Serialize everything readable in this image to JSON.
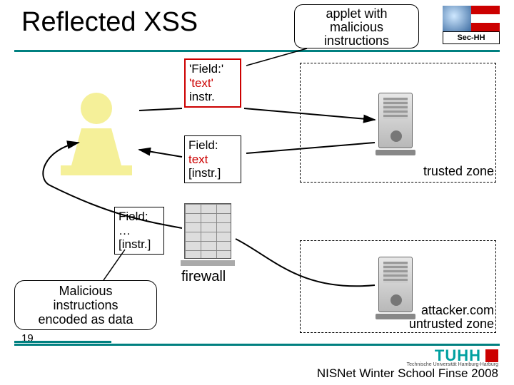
{
  "title": "Reflected XSS",
  "applet_bubble": {
    "l1": "applet with",
    "l2": "malicious",
    "l3": "instructions"
  },
  "sechh_label": "Sec-HH",
  "msg1": {
    "l1": "'Field:'",
    "l2": "'text'",
    "l3": "instr."
  },
  "msg2": {
    "l1": "Field:",
    "l2": "text",
    "l3": "[instr.]"
  },
  "msg3": {
    "l1": "Field:",
    "l2": "…",
    "l3": "[instr.]"
  },
  "zones": {
    "trusted": "trusted zone",
    "attacker": "attacker.com",
    "untrusted": "untrusted zone"
  },
  "firewall_label": "firewall",
  "malicious_bubble": {
    "l1": "Malicious",
    "l2": "instructions",
    "l3": "encoded as data"
  },
  "slide_number": "19",
  "tuhh": "TUHH",
  "tuhh_sub": "Technische Universität Hamburg-Harburg",
  "footer": "NISNet Winter School Finse 2008"
}
